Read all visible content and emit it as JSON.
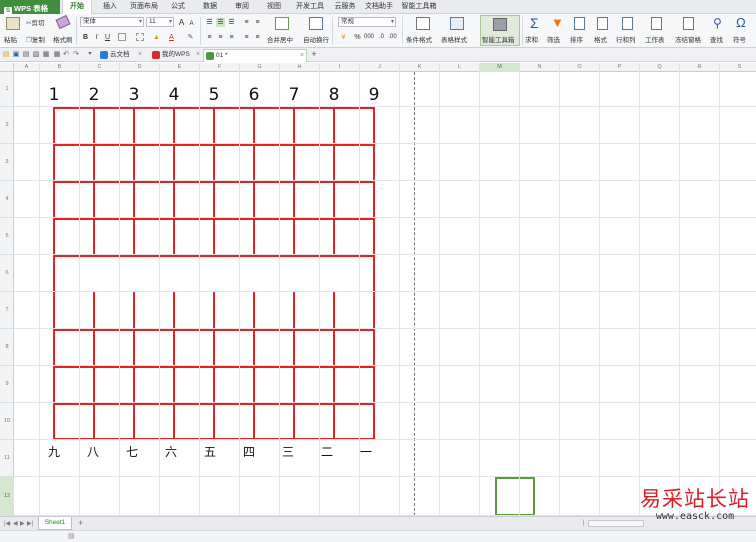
{
  "app": {
    "name": "WPS 表格",
    "logo": "S"
  },
  "menu_tabs": [
    "开始",
    "插入",
    "页面布局",
    "公式",
    "数据",
    "审阅",
    "视图",
    "开发工具",
    "云服务",
    "文档助手",
    "智能工具箱"
  ],
  "ribbon": {
    "cut": "剪切",
    "paste": "粘贴",
    "copy": "复制",
    "format_painter": "格式刷",
    "font_name": "宋体",
    "font_size": "11",
    "bold": "B",
    "italic": "I",
    "underline": "U",
    "number_format": "常规",
    "merge_center": "合并居中",
    "wrap_text": "自动换行",
    "percent": "%",
    "conditional_format": "条件格式",
    "table_style": "表格样式",
    "smart_toolbox": "智能工具箱",
    "sum": "求和",
    "filter": "筛选",
    "sort": "排序",
    "format": "格式",
    "row_col": "行和列",
    "worksheet": "工作表",
    "freeze": "冻结窗格",
    "find": "查找",
    "symbol": "符号"
  },
  "doc_tabs": [
    {
      "label": "云文档",
      "color": "#2a7bd4"
    },
    {
      "label": "我的WPS",
      "color": "#d42a2a"
    },
    {
      "label": "01 *",
      "color": "#4a9a3a"
    }
  ],
  "columns": [
    "A",
    "B",
    "C",
    "D",
    "E",
    "F",
    "G",
    "H",
    "I",
    "J",
    "K",
    "L",
    "M",
    "N",
    "O",
    "P",
    "Q",
    "R",
    "S"
  ],
  "selected_column": "M",
  "rows": [
    "1",
    "2",
    "3",
    "4",
    "5",
    "6",
    "7",
    "8",
    "9",
    "10",
    "11",
    "12"
  ],
  "selected_row": "12",
  "board": {
    "top_numbers": [
      "1",
      "2",
      "3",
      "4",
      "5",
      "6",
      "7",
      "8",
      "9"
    ],
    "bottom_numbers": [
      "九",
      "八",
      "七",
      "六",
      "五",
      "四",
      "三",
      "二",
      "一"
    ],
    "line_color": "#e32424"
  },
  "sheet_tab": "Sheet1",
  "watermark": {
    "title": "易采站长站",
    "url": "www.easck.com"
  }
}
